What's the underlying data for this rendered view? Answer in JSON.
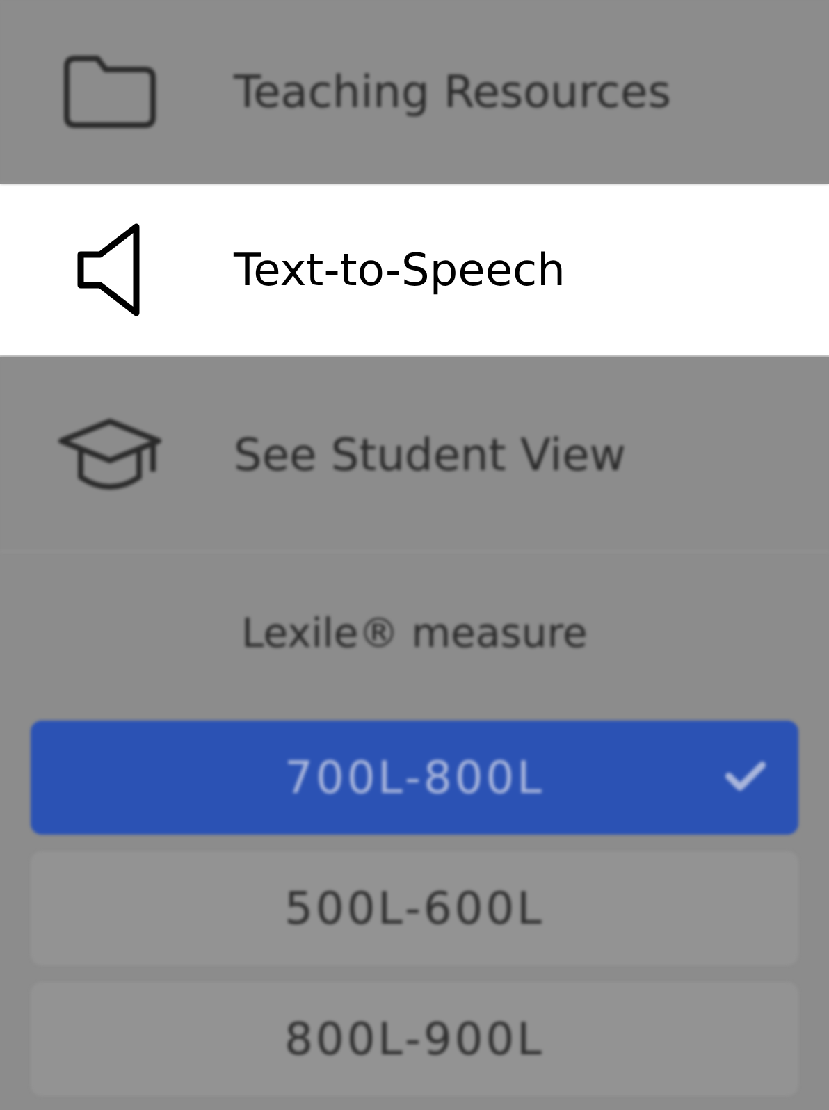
{
  "menu_items": [
    {
      "label": "Teaching Resources",
      "highlighted": false
    },
    {
      "label": "Text-to-Speech",
      "highlighted": true
    },
    {
      "label": "See Student View",
      "highlighted": false
    }
  ],
  "lexile": {
    "heading": "Lexile® measure",
    "highlighted": false,
    "options": [
      {
        "label": "700L-800L",
        "selected": true
      },
      {
        "label": "500L-600L",
        "selected": false
      },
      {
        "label": "800L-900L",
        "selected": false
      }
    ]
  }
}
